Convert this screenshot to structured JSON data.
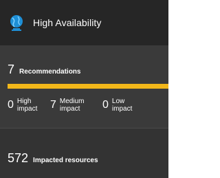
{
  "header": {
    "title": "High Availability",
    "icon": "globe-icon"
  },
  "recommendations": {
    "count": "7",
    "label": "Recommendations",
    "severity_bar": {
      "medium_fraction": 1.0,
      "color": "#f2b71a"
    }
  },
  "impacts": [
    {
      "count": "0",
      "label_line1": "High",
      "label_line2": "impact"
    },
    {
      "count": "7",
      "label_line1": "Medium",
      "label_line2": "impact"
    },
    {
      "count": "0",
      "label_line1": "Low",
      "label_line2": "impact"
    }
  ],
  "impacted_resources": {
    "count": "572",
    "label": "Impacted resources"
  }
}
